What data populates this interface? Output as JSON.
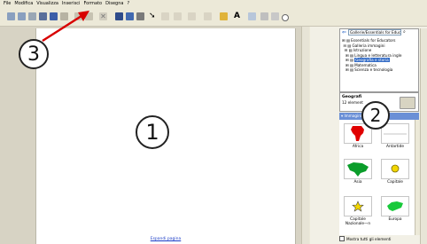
{
  "menu": [
    "File",
    "Modifica",
    "Visualizza",
    "Inserisci",
    "Formato",
    "Disegna",
    "?"
  ],
  "document": {
    "expand_link": "Espandi pagina"
  },
  "gallery_panel": {
    "address": "Gallerie/Essentials for Educators",
    "tree": [
      "Essentials for Educators",
      "Galleria immagini",
      "Istruzione",
      "Lingua e letteratura ingle",
      "Geografia e storia",
      "Matematica",
      "Scienza e tecnologia"
    ],
    "selected_index": 4
  },
  "gallery_header": {
    "title": "Geografi",
    "count": "12 element"
  },
  "section": {
    "title": "Immagini e sfondi (8)"
  },
  "items": [
    {
      "label": "Africa"
    },
    {
      "label": "Antartide"
    },
    {
      "label": "Asia"
    },
    {
      "label": "Capitale"
    },
    {
      "label": "Capitale Nazionale—n"
    },
    {
      "label": "Europa"
    }
  ],
  "footer": {
    "checkbox_label": "Mostra tutti gli elementi"
  },
  "callouts": {
    "one": "1",
    "two": "2",
    "three": "3"
  }
}
